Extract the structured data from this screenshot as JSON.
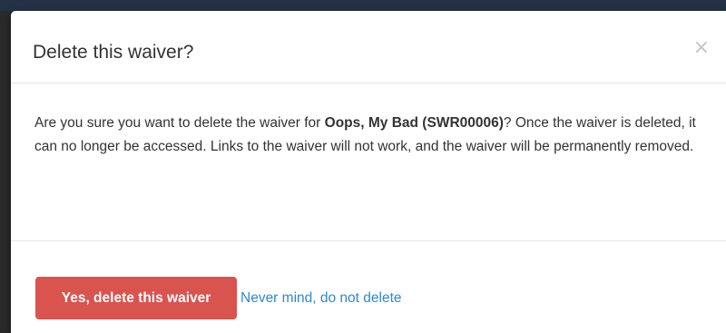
{
  "modal": {
    "title": "Delete this waiver?",
    "close_glyph": "×",
    "body": {
      "text_before": "Are you sure you want to delete the waiver for ",
      "waiver_name": "Oops, My Bad (SWR00006)",
      "text_after": "? Once the waiver is deleted, it can no longer be accessed. Links to the waiver will not work, and the waiver will be permanently removed."
    },
    "footer": {
      "confirm_label": "Yes, delete this waiver",
      "cancel_label": "Never mind, do not delete"
    }
  },
  "colors": {
    "danger": "#d9534f",
    "link": "#2a8ad4",
    "text": "#333333",
    "backdrop": "#1f2b3b"
  },
  "icons": {
    "close": "close-icon"
  }
}
